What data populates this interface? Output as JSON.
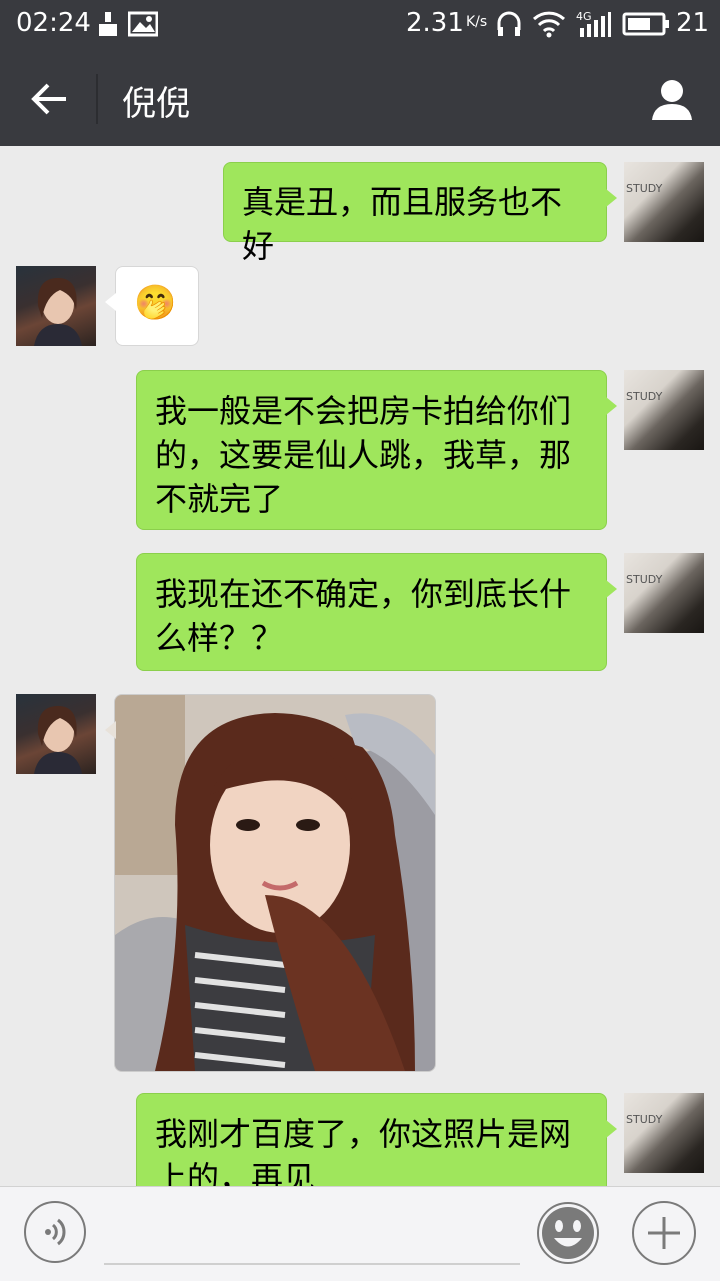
{
  "status_bar": {
    "time": "02:24",
    "net_speed": "2.31",
    "net_speed_unit": "K/s",
    "network": "4G",
    "battery": "21"
  },
  "header": {
    "title": "倪倪"
  },
  "messages": [
    {
      "side": "me",
      "type": "text",
      "text": "真是丑，而且服务也不好"
    },
    {
      "side": "her",
      "type": "emoji",
      "emoji": "🤭"
    },
    {
      "side": "me",
      "type": "text",
      "text": "我一般是不会把房卡拍给你们\n的，这要是仙人跳，我草，那\n不就完了"
    },
    {
      "side": "me",
      "type": "text",
      "text": "我现在还不确定，你到底长什\n么样？？"
    },
    {
      "side": "her",
      "type": "image"
    },
    {
      "side": "me",
      "type": "text",
      "text": "我刚才百度了，你这照片是网\n上的，再见"
    }
  ],
  "avatar_me_text": "STUDY",
  "colors": {
    "header_bg": "#393a3f",
    "chat_bg": "#ebebeb",
    "my_bubble": "#9fe65c",
    "her_bubble": "#ffffff"
  },
  "icons": {
    "back": "arrow-left-icon",
    "profile": "person-icon",
    "voice": "voice-icon",
    "emoji": "smiley-icon",
    "more": "plus-icon"
  }
}
